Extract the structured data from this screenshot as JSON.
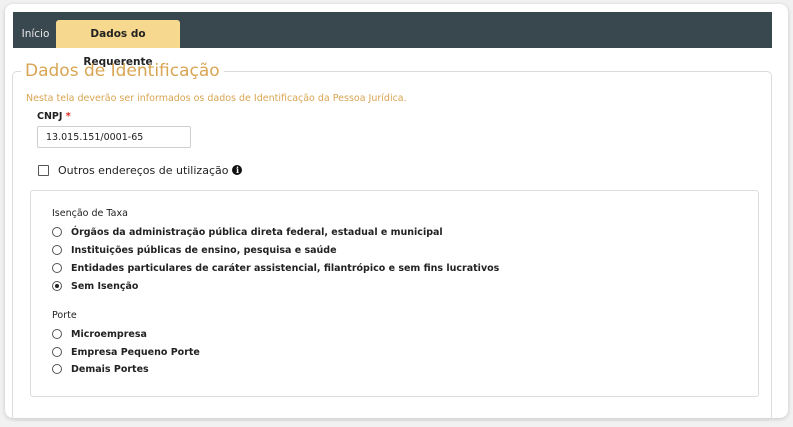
{
  "tabs": [
    {
      "label": "Início",
      "active": false
    },
    {
      "label": "Dados do Requerente",
      "active": true
    }
  ],
  "section": {
    "legend": "Dados de Identificação",
    "intro": "Nesta tela deverão ser informados os dados de Identificação da Pessoa Jurídica."
  },
  "cnpj": {
    "label": "CNPJ",
    "required_mark": "*",
    "value": "13.015.151/0001-65"
  },
  "outros_enderecos": {
    "label": "Outros endereços de utilização",
    "checked": false,
    "info_icon": "info-circle-icon"
  },
  "isencao": {
    "title": "Isenção de Taxa",
    "options": [
      {
        "label": "Órgãos da administração pública direta federal, estadual e municipal",
        "checked": false
      },
      {
        "label": "Instituições públicas de ensino, pesquisa e saúde",
        "checked": false
      },
      {
        "label": "Entidades particulares de caráter assistencial, filantrópico e sem fins lucrativos",
        "checked": false
      },
      {
        "label": "Sem Isenção",
        "checked": true
      }
    ]
  },
  "porte": {
    "title": "Porte",
    "options": [
      {
        "label": "Microempresa",
        "checked": false
      },
      {
        "label": "Empresa Pequeno Porte",
        "checked": false
      },
      {
        "label": "Demais Portes",
        "checked": false
      }
    ]
  },
  "colors": {
    "tab_bar": "#39474f",
    "tab_active": "#f6d98e",
    "accent_text": "#d9a553",
    "required": "#d9261c"
  }
}
